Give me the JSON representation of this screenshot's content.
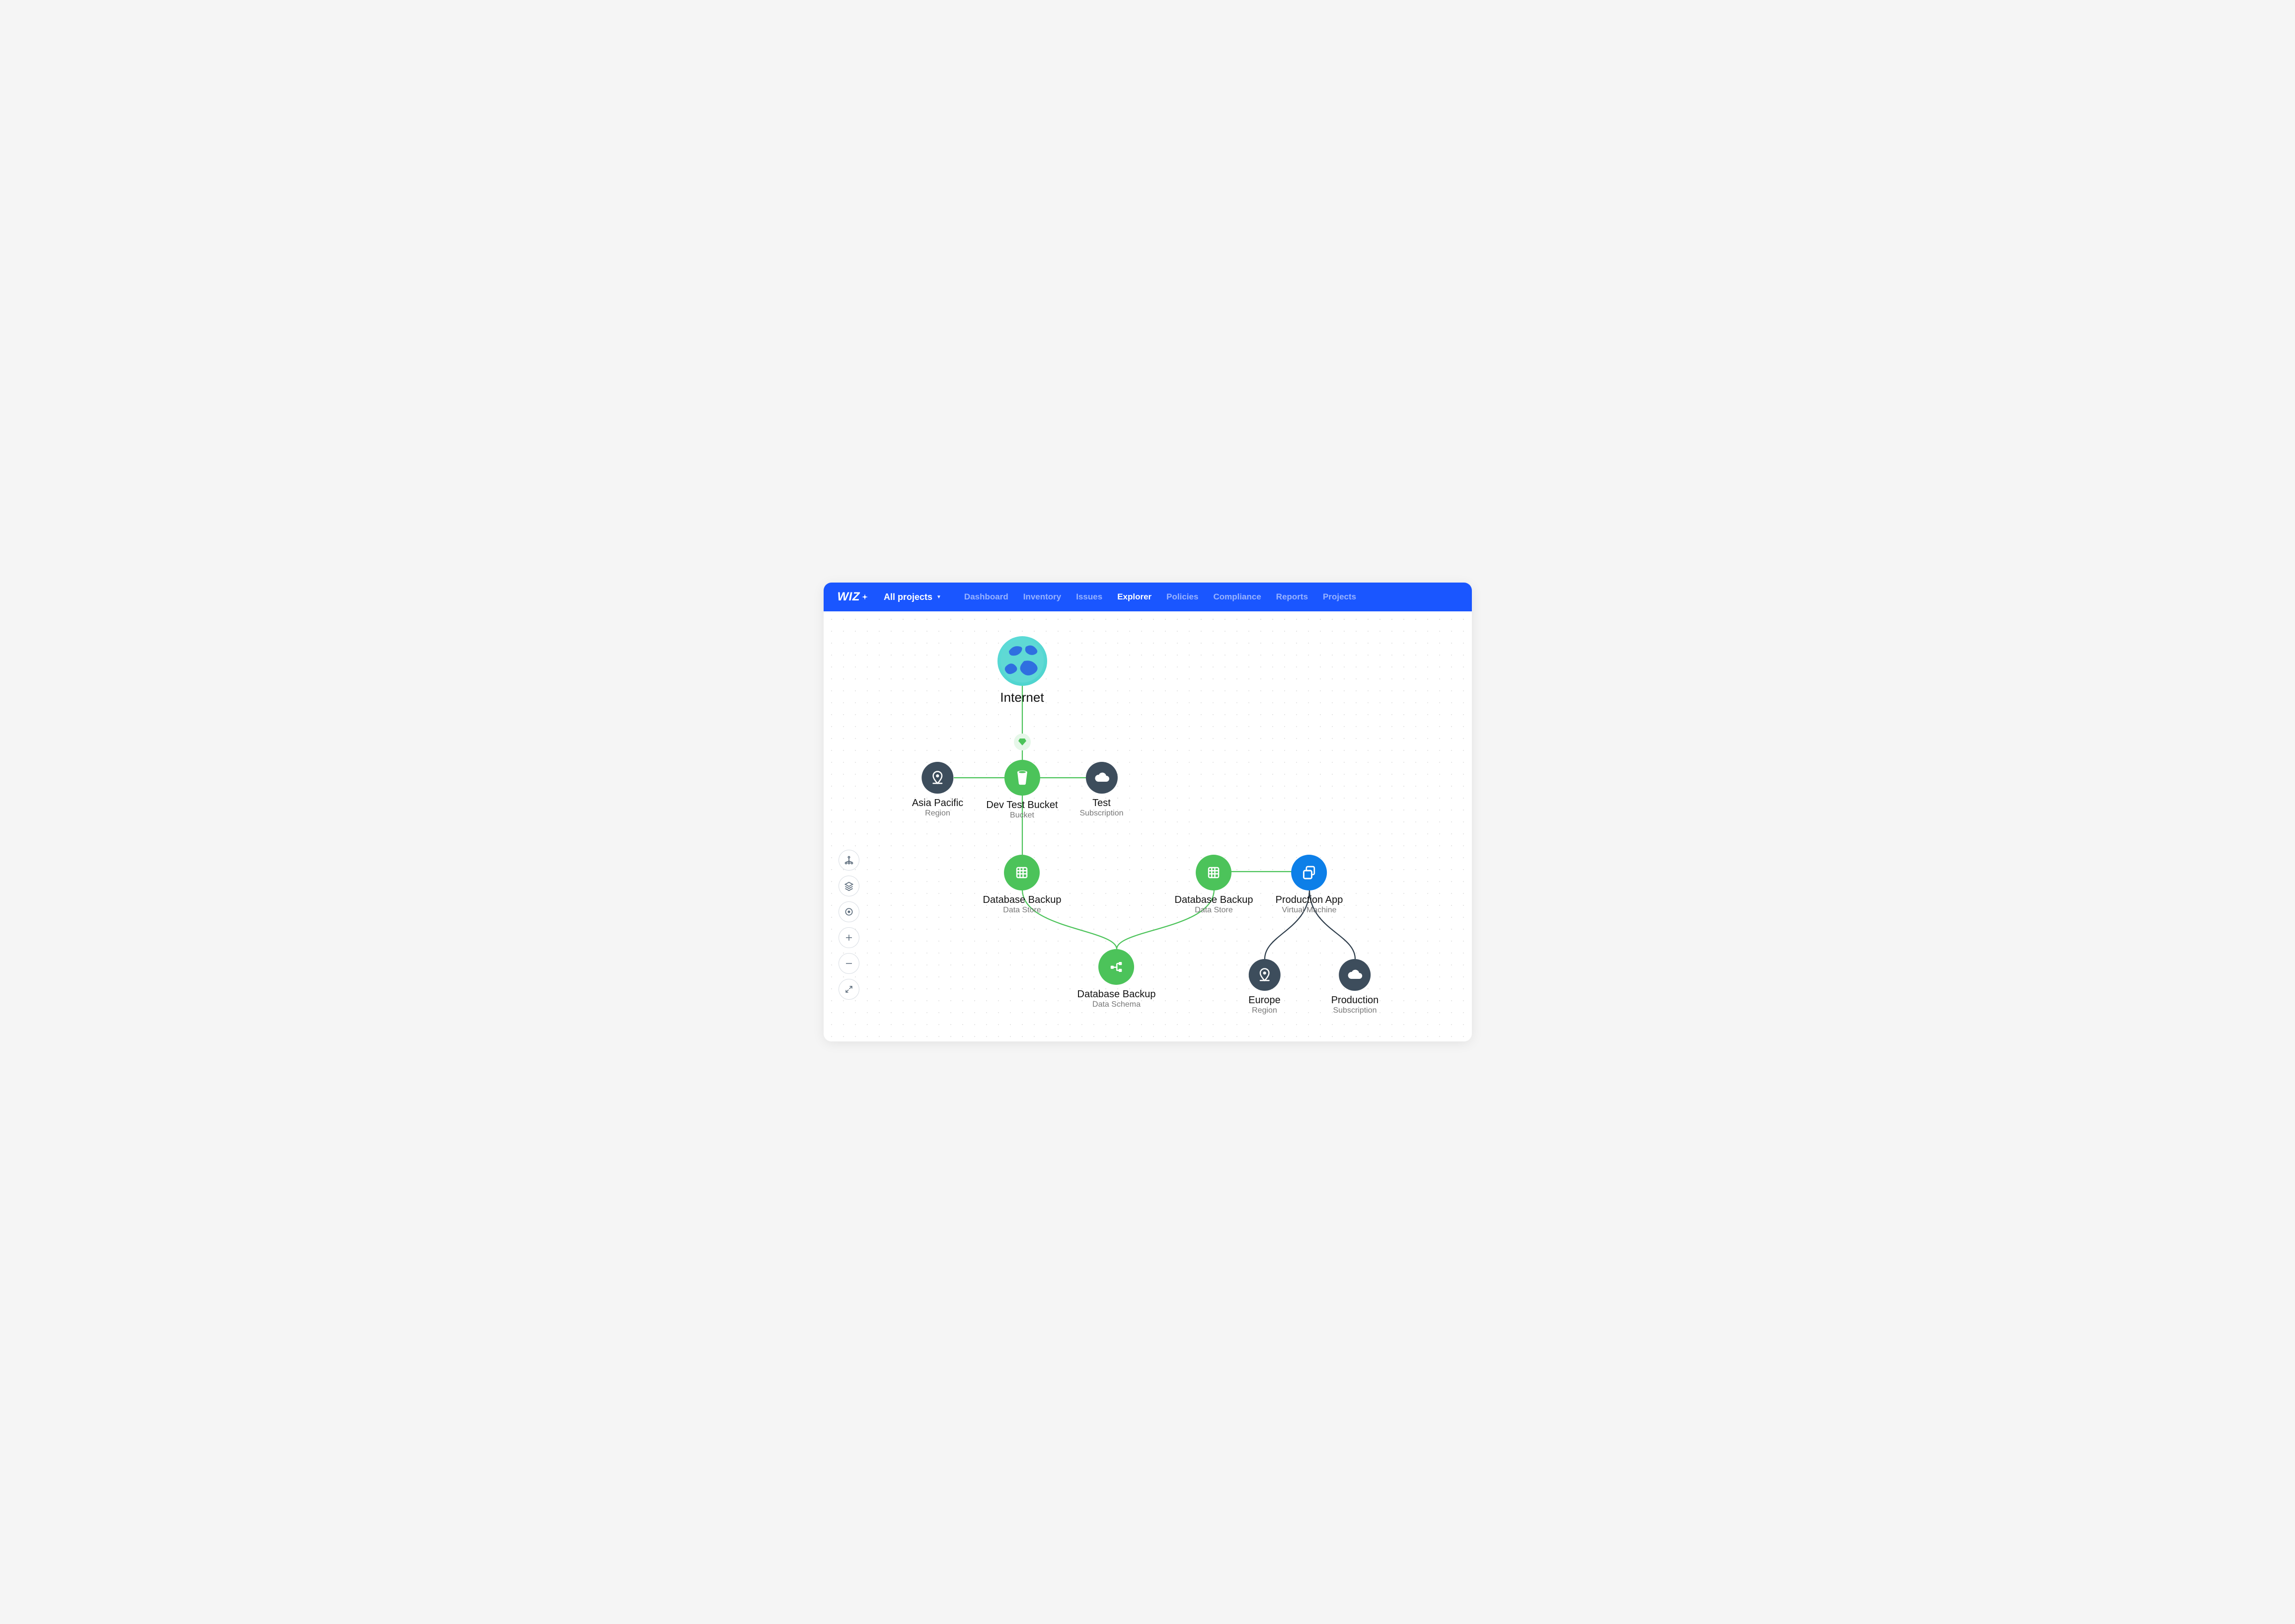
{
  "brand": {
    "name": "WIZ"
  },
  "project_switcher": {
    "label": "All projects"
  },
  "nav": {
    "items": [
      {
        "label": "Dashboard",
        "active": false
      },
      {
        "label": "Inventory",
        "active": false
      },
      {
        "label": "Issues",
        "active": false
      },
      {
        "label": "Explorer",
        "active": true
      },
      {
        "label": "Policies",
        "active": false
      },
      {
        "label": "Compliance",
        "active": false
      },
      {
        "label": "Reports",
        "active": false
      },
      {
        "label": "Projects",
        "active": false
      }
    ]
  },
  "graph": {
    "nodes": {
      "internet": {
        "title": "Internet",
        "subtitle": ""
      },
      "asia": {
        "title": "Asia Pacific",
        "subtitle": "Region"
      },
      "bucket": {
        "title": "Dev Test Bucket",
        "subtitle": "Bucket"
      },
      "test": {
        "title": "Test",
        "subtitle": "Subscription"
      },
      "db1": {
        "title": "Database Backup",
        "subtitle": "Data Store"
      },
      "db2": {
        "title": "Database Backup",
        "subtitle": "Data Store"
      },
      "schema": {
        "title": "Database Backup",
        "subtitle": "Data Schema"
      },
      "prodapp": {
        "title": "Production App",
        "subtitle": "Virtual Machine"
      },
      "europe": {
        "title": "Europe",
        "subtitle": "Region"
      },
      "production": {
        "title": "Production",
        "subtitle": "Subscription"
      }
    }
  },
  "colors": {
    "brand_bg": "#1a56ff",
    "node_green": "#4cc35a",
    "node_slate": "#3d4d5c",
    "node_blue": "#0d7fe8",
    "edge_green": "#4cc35a",
    "edge_dark": "#2e3d4b"
  }
}
